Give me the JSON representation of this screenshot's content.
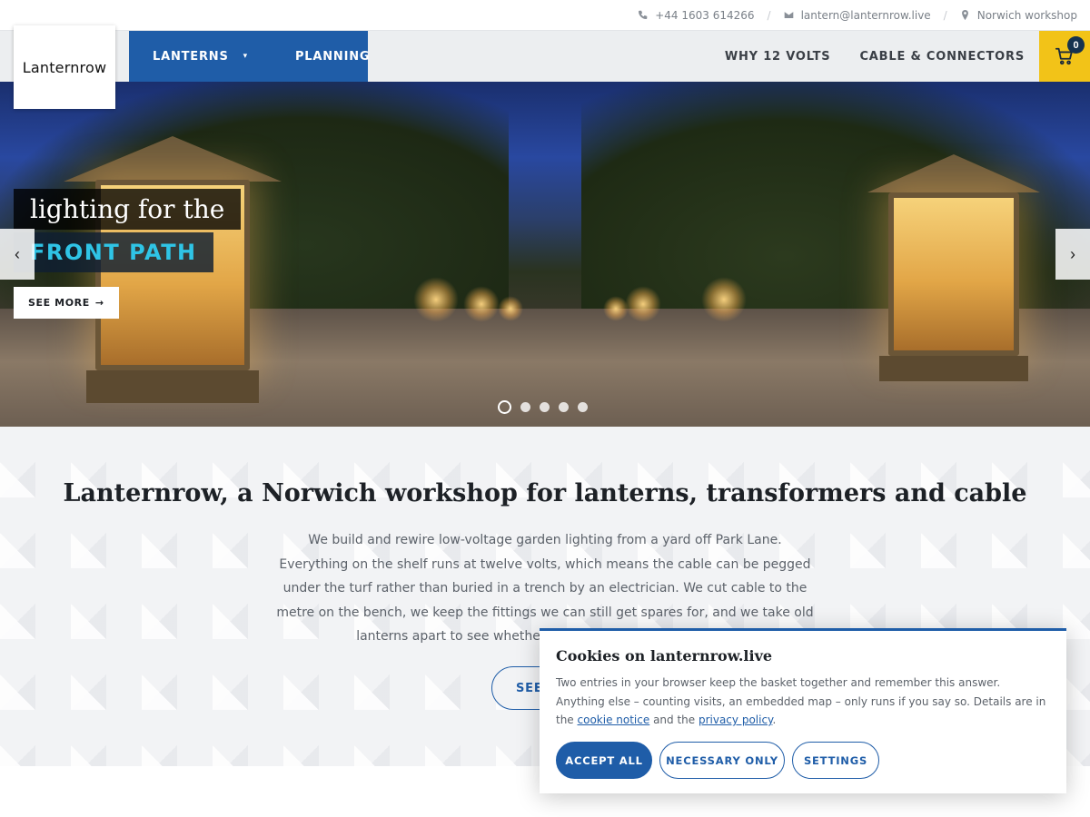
{
  "topbar": {
    "phone": "+44 1603 614266",
    "email": "lantern@lanternrow.live",
    "location": "Norwich workshop",
    "separator": "/"
  },
  "logo": {
    "text": "Lanternrow"
  },
  "nav": {
    "left": [
      {
        "label": "LANTERNS",
        "has_dropdown": true
      },
      {
        "label": "PLANNING",
        "has_dropdown": false
      }
    ],
    "right": [
      {
        "label": "WHY 12 VOLTS"
      },
      {
        "label": "CABLE & CONNECTORS"
      }
    ],
    "cart_count": "0"
  },
  "hero": {
    "line1": "lighting for the",
    "line2": "FRONT PATH",
    "cta": "SEE MORE",
    "prev_icon": "‹",
    "next_icon": "›",
    "slides": 5,
    "active_slide": 1
  },
  "intro": {
    "heading": "Lanternrow, a Norwich workshop for lanterns, transformers and cable",
    "paragraph": "We build and rewire low-voltage garden lighting from a yard off Park Lane. Everything on the shelf runs at twelve volts, which means the cable can be pegged under the turf rather than buried in a trench by an electrician. We cut cable to the metre on the bench, we keep the fittings we can still get spares for, and we take old lanterns apart to see whether they are worth saving before",
    "button": "SEE"
  },
  "cookie": {
    "title": "Cookies on lanternrow.live",
    "text_before": "Two entries in your browser keep the basket together and remember this answer. Anything else – counting visits, an embedded map – only runs if you say so. Details are in the ",
    "link1": "cookie notice",
    "text_mid": " and the ",
    "link2": "privacy policy",
    "text_after": ".",
    "accept_all": "ACCEPT ALL",
    "necessary_only": "NECESSARY ONLY",
    "settings": "SETTINGS"
  },
  "colors": {
    "brand_blue": "#1f5da8",
    "cart_yellow": "#f2c318",
    "accent_cyan": "#2fc4e6"
  }
}
